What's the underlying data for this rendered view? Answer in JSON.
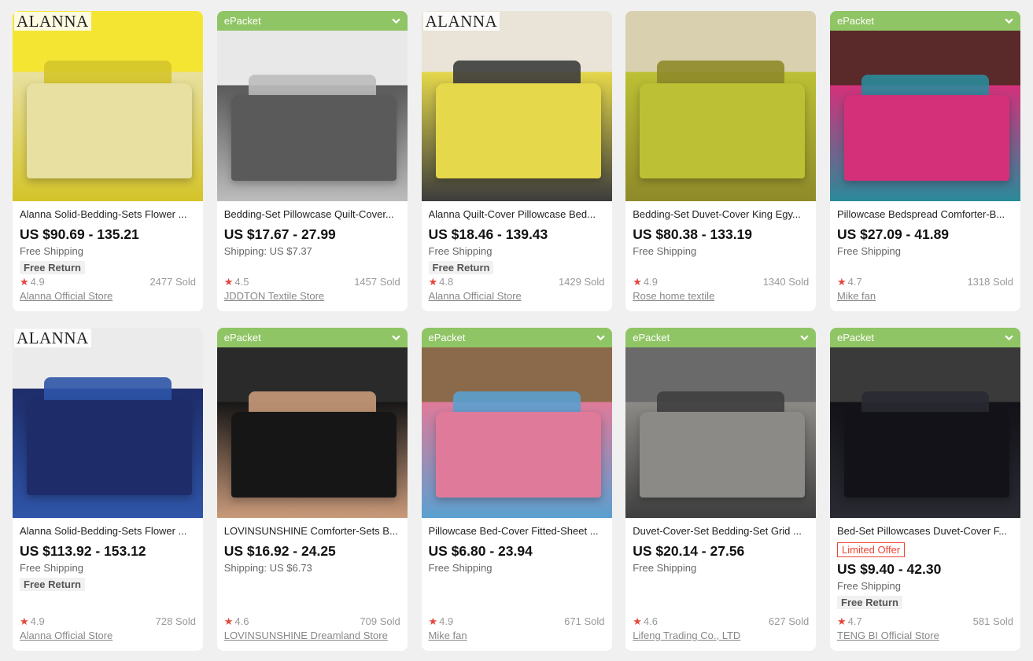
{
  "accent": "#8fc564",
  "products": [
    {
      "epacket": false,
      "brand_tag": "ALANNA",
      "title": "Alanna Solid-Bedding-Sets Flower ...",
      "price": "US $90.69 - 135.21",
      "shipping": "Free Shipping",
      "free_return": "Free Return",
      "limited": "",
      "rating": "4.9",
      "sold": "2477 Sold",
      "store": "Alanna Official Store",
      "colors": [
        "#f5e533",
        "#e8e0a0",
        "#d4c42a"
      ]
    },
    {
      "epacket": true,
      "epacket_label": "ePacket",
      "brand_tag": "",
      "title": "Bedding-Set Pillowcase Quilt-Cover...",
      "price": "US $17.67 - 27.99",
      "shipping": "Shipping: US $7.37",
      "free_return": "",
      "limited": "",
      "rating": "4.5",
      "sold": "1457 Sold",
      "store": "JDDTON Textile Store",
      "colors": [
        "#e8e8e8",
        "#5a5a5a",
        "#bcbcbc"
      ]
    },
    {
      "epacket": false,
      "brand_tag": "ALANNA",
      "title": "Alanna Quilt-Cover Pillowcase Bed...",
      "price": "US $18.46 - 139.43",
      "shipping": "Free Shipping",
      "free_return": "Free Return",
      "limited": "",
      "rating": "4.8",
      "sold": "1429 Sold",
      "store": "Alanna Official Store",
      "colors": [
        "#e9e3d8",
        "#e5d84a",
        "#3c3c3c"
      ]
    },
    {
      "epacket": false,
      "brand_tag": "",
      "title": "Bedding-Set Duvet-Cover King Egy...",
      "price": "US $80.38 - 133.19",
      "shipping": "Free Shipping",
      "free_return": "",
      "limited": "",
      "rating": "4.9",
      "sold": "1340 Sold",
      "store": "Rose home textile",
      "colors": [
        "#d9d0b0",
        "#bcc034",
        "#8e8a2a"
      ]
    },
    {
      "epacket": true,
      "epacket_label": "ePacket",
      "brand_tag": "",
      "title": "Pillowcase Bedspread Comforter-B...",
      "price": "US $27.09 - 41.89",
      "shipping": "Free Shipping",
      "free_return": "",
      "limited": "",
      "rating": "4.7",
      "sold": "1318 Sold",
      "store": "Mike fan",
      "colors": [
        "#5a2a2a",
        "#d4307a",
        "#2a8a9a"
      ]
    },
    {
      "epacket": false,
      "brand_tag": "ALANNA",
      "title": "Alanna Solid-Bedding-Sets Flower ...",
      "price": "US $113.92 - 153.12",
      "shipping": "Free Shipping",
      "free_return": "Free Return",
      "limited": "",
      "rating": "4.9",
      "sold": "728 Sold",
      "store": "Alanna Official Store",
      "colors": [
        "#ebebeb",
        "#1e2c6a",
        "#2f55a8"
      ]
    },
    {
      "epacket": true,
      "epacket_label": "ePacket",
      "brand_tag": "",
      "title": "LOVINSUNSHINE Comforter-Sets B...",
      "price": "US $16.92 - 24.25",
      "shipping": "Shipping: US $6.73",
      "free_return": "",
      "limited": "",
      "rating": "4.6",
      "sold": "709 Sold",
      "store": "LOVINSUNSHINE Dreamland Store",
      "colors": [
        "#2a2a2a",
        "#161616",
        "#c99a7a"
      ]
    },
    {
      "epacket": true,
      "epacket_label": "ePacket",
      "brand_tag": "",
      "title": "Pillowcase Bed-Cover Fitted-Sheet ...",
      "price": "US $6.80 - 23.94",
      "shipping": "Free Shipping",
      "free_return": "",
      "limited": "",
      "rating": "4.9",
      "sold": "671 Sold",
      "store": "Mike fan",
      "colors": [
        "#8a6a4a",
        "#e07a9a",
        "#5aa0d0"
      ]
    },
    {
      "epacket": true,
      "epacket_label": "ePacket",
      "brand_tag": "",
      "title": "Duvet-Cover-Set Bedding-Set Grid ...",
      "price": "US $20.14 - 27.56",
      "shipping": "Free Shipping",
      "free_return": "",
      "limited": "",
      "rating": "4.6",
      "sold": "627 Sold",
      "store": "Lifeng Trading Co., LTD",
      "colors": [
        "#6a6a6a",
        "#8c8a86",
        "#3f3f3f"
      ]
    },
    {
      "epacket": true,
      "epacket_label": "ePacket",
      "brand_tag": "",
      "title": "Bed-Set Pillowcases Duvet-Cover F...",
      "price": "US $9.40 - 42.30",
      "shipping": "Free Shipping",
      "free_return": "Free Return",
      "limited": "Limited Offer",
      "rating": "4.7",
      "sold": "581 Sold",
      "store": "TENG BI Official Store",
      "colors": [
        "#3a3a3a",
        "#121218",
        "#2a2a33"
      ]
    }
  ]
}
